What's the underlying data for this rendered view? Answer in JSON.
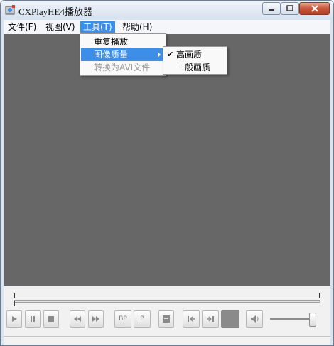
{
  "window": {
    "title": "CXPlayHE4播放器",
    "controls": [
      "minimize-button",
      "maximize-button",
      "close-button"
    ]
  },
  "menubar": {
    "items": [
      {
        "label": "文件(F)"
      },
      {
        "label": "视图(V)"
      },
      {
        "label": "工具(T)",
        "active": true
      },
      {
        "label": "帮助(H)"
      }
    ]
  },
  "tools_menu": {
    "items": [
      {
        "label": "重复播放",
        "state": "normal"
      },
      {
        "label": "图像质量",
        "state": "highlighted",
        "has_submenu": true
      },
      {
        "label": "转换为AVI文件",
        "state": "disabled"
      }
    ]
  },
  "quality_submenu": {
    "items": [
      {
        "label": "高画质",
        "checked": true
      },
      {
        "label": "一般画质",
        "checked": false
      }
    ]
  },
  "controls": {
    "buttons": [
      {
        "name": "play",
        "icon": "play-icon"
      },
      {
        "name": "pause",
        "icon": "pause-icon"
      },
      {
        "name": "stop",
        "icon": "stop-icon"
      },
      {
        "name": "rewind",
        "icon": "rewind-icon"
      },
      {
        "name": "fast-forward",
        "icon": "fast-forward-icon"
      },
      {
        "name": "bp",
        "label": "BP"
      },
      {
        "name": "p",
        "label": "P"
      },
      {
        "name": "screen",
        "icon": "screen-icon"
      },
      {
        "name": "prev",
        "icon": "skip-back-icon"
      },
      {
        "name": "next",
        "icon": "skip-forward-icon"
      },
      {
        "name": "volume",
        "icon": "speaker-icon"
      }
    ],
    "seek_position": 0,
    "volume_level": 0.9
  },
  "colors": {
    "video_background": "#676767",
    "menu_highlight": "#3d8ee7",
    "disabled_text": "#9c9c9c"
  }
}
